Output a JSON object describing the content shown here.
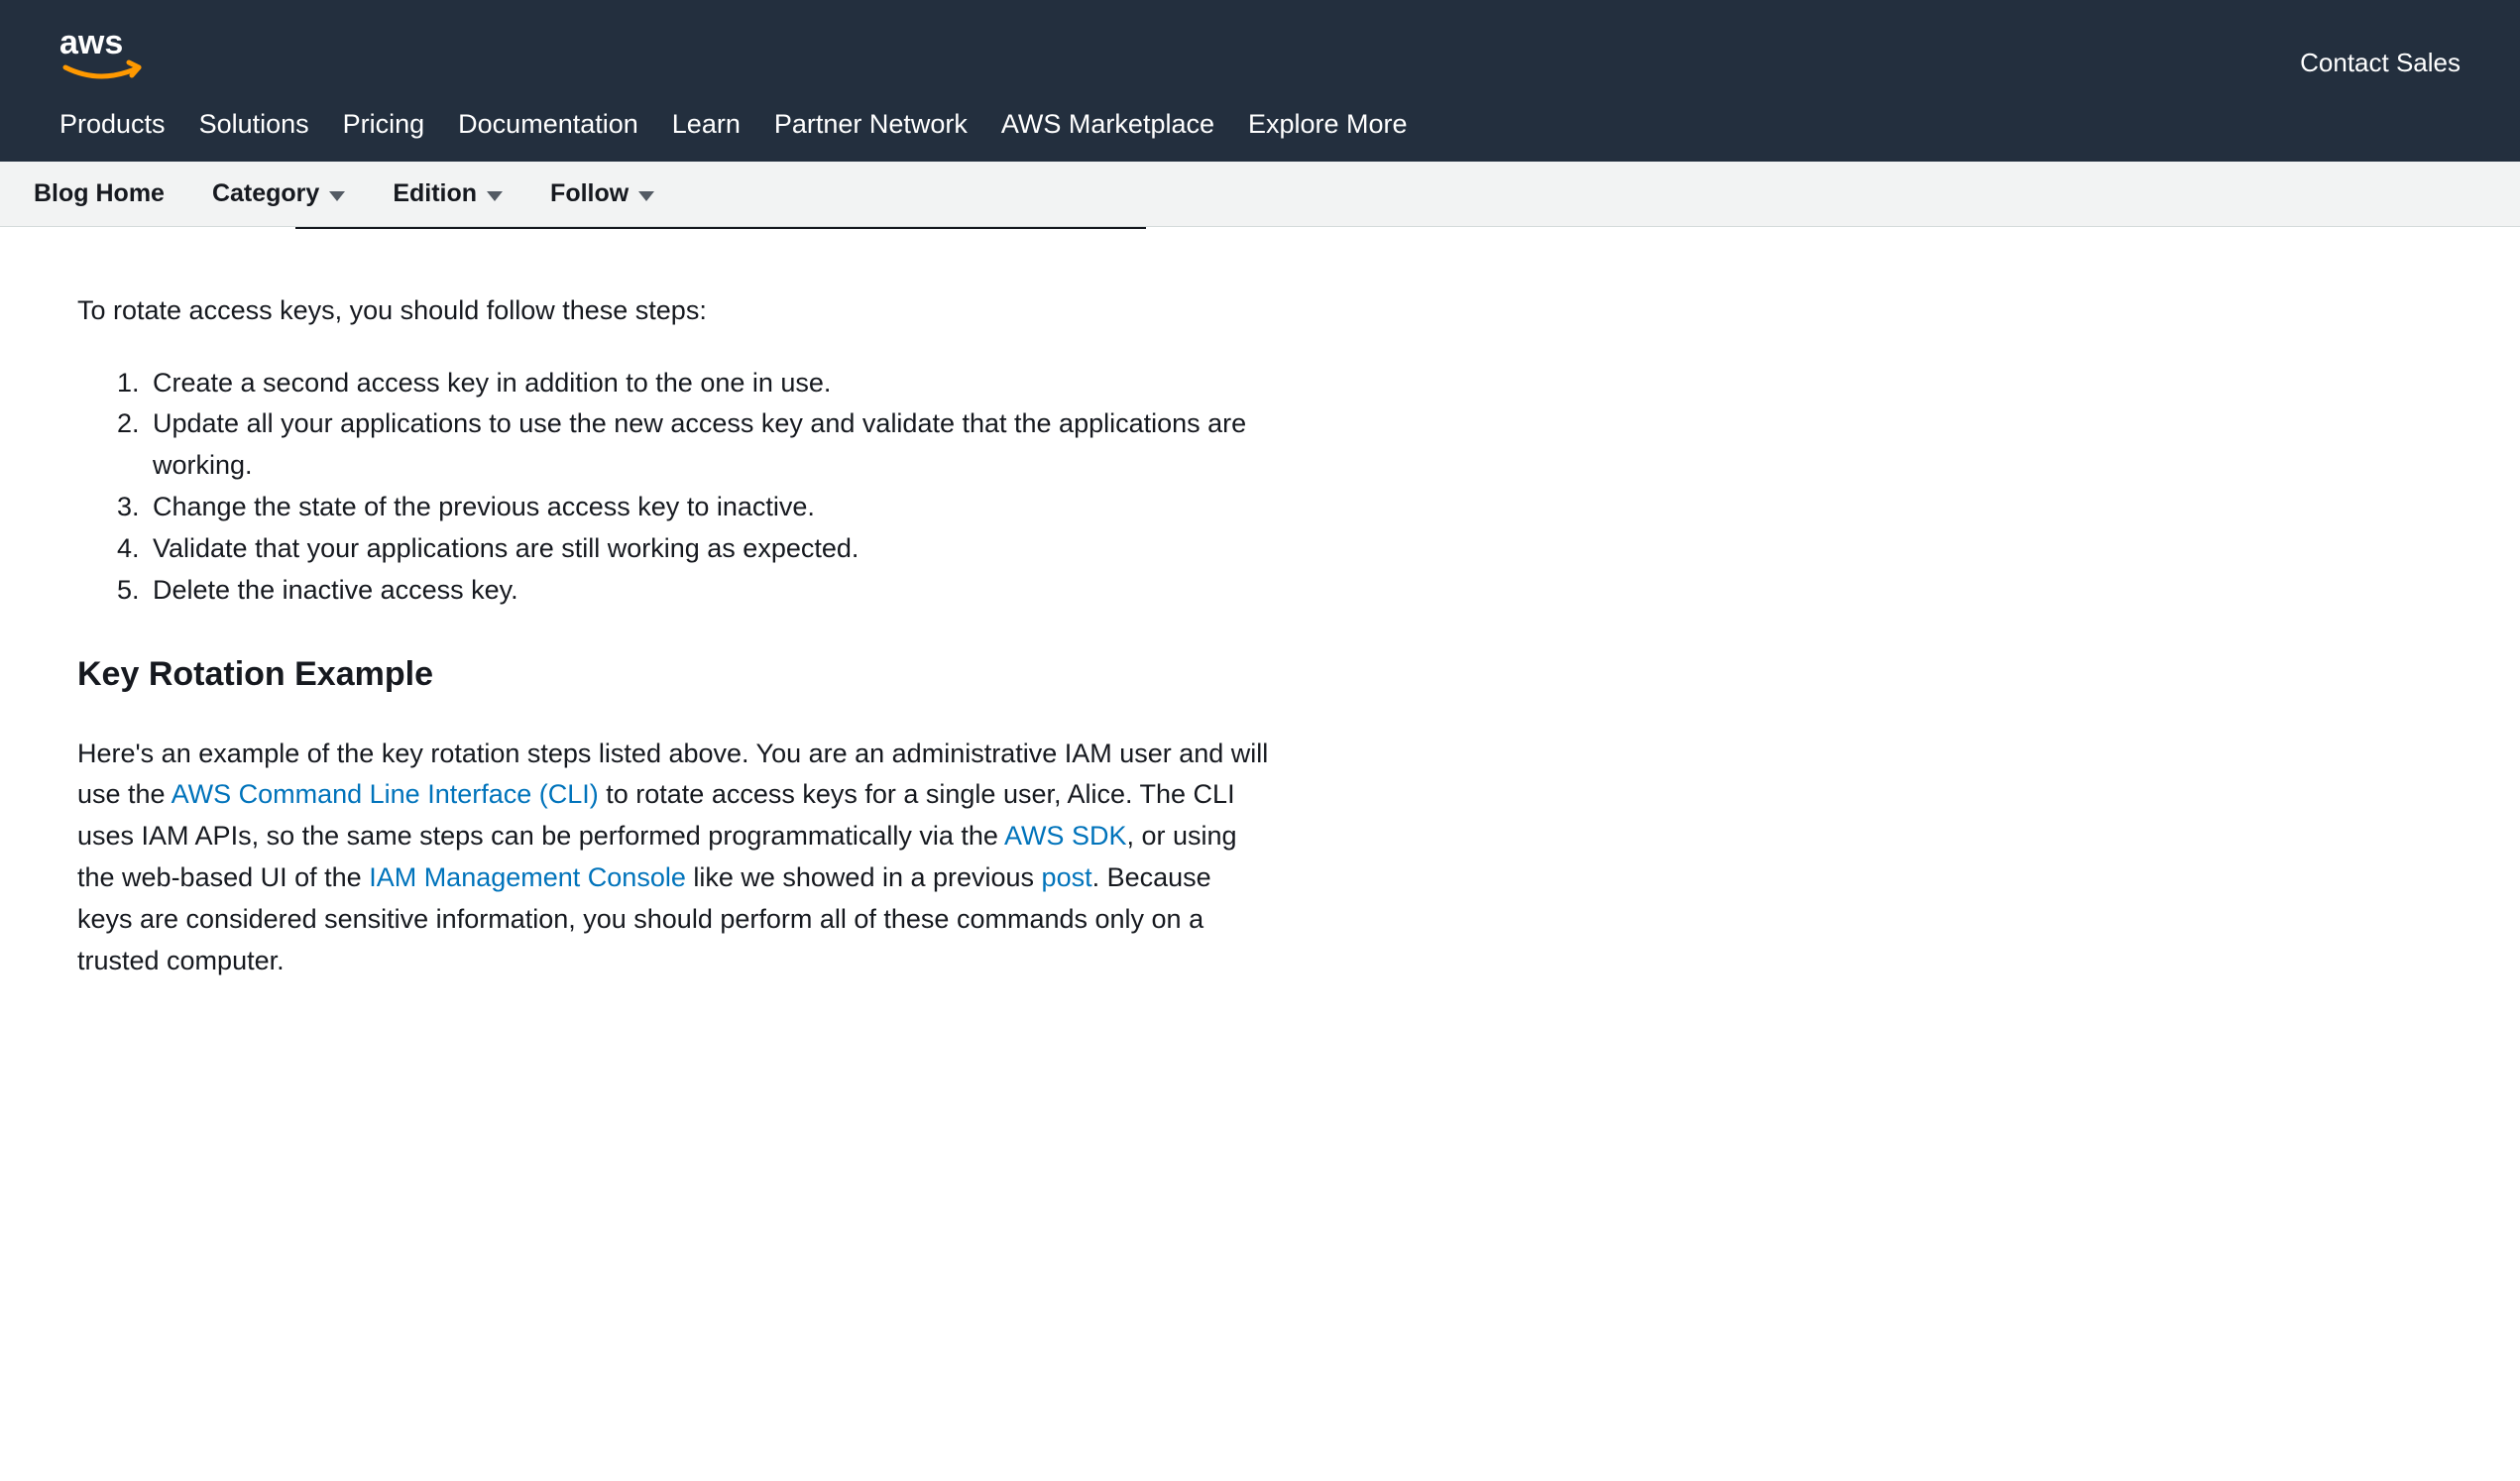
{
  "header": {
    "contact_label": "Contact Sales",
    "nav": {
      "products": "Products",
      "solutions": "Solutions",
      "pricing": "Pricing",
      "documentation": "Documentation",
      "learn": "Learn",
      "partner_network": "Partner Network",
      "marketplace": "AWS Marketplace",
      "explore_more": "Explore More"
    }
  },
  "subnav": {
    "blog_home": "Blog Home",
    "category": "Category",
    "edition": "Edition",
    "follow": "Follow"
  },
  "article": {
    "intro": "To rotate access keys, you should follow these steps:",
    "steps": [
      "Create a second access key in addition to the one in use.",
      "Update all your applications to use the new access key and validate that the applications are working.",
      "Change the state of the previous access key to inactive.",
      "Validate that your applications are still working as expected.",
      "Delete the inactive access key."
    ],
    "section_heading": "Key Rotation Example",
    "para": {
      "seg1": "Here's an example of the key rotation steps listed above. You are an administrative IAM user and will use the ",
      "link1": "AWS Command Line Interface (CLI)",
      "seg2": " to rotate access keys for a single user, Alice. The CLI uses IAM APIs, so the same steps can be performed programmatically via the ",
      "link2": "AWS SDK",
      "seg3": ", or using the web-based UI of the ",
      "link3": "IAM Management Console",
      "seg4": " like we showed in a previous ",
      "link4": "post",
      "seg5": ". Because keys are considered sensitive information, you should perform all of these commands only on a trusted computer."
    }
  }
}
